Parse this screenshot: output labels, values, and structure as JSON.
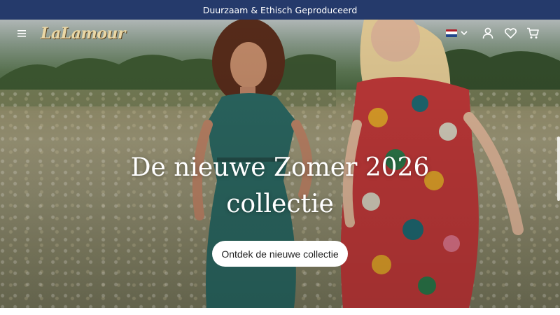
{
  "announcement": {
    "text": "Duurzaam & Ethisch Geproduceerd"
  },
  "header": {
    "logo_text": "LaLamour",
    "icons": [
      "menu-icon",
      "flag-icon",
      "chevron-down-icon",
      "user-icon",
      "heart-icon",
      "cart-icon"
    ],
    "language": {
      "flag_colors": [
        "#ae1c28",
        "#ffffff",
        "#21468b"
      ]
    }
  },
  "hero": {
    "title_line1": "De nieuwe Zomer 2026",
    "title_line2": "collectie",
    "cta_label": "Ontdek de nieuwe collectie"
  },
  "colors": {
    "announcement_bg": "#253a6b",
    "logo": "#ead7a5",
    "cta_bg": "#ffffff"
  }
}
